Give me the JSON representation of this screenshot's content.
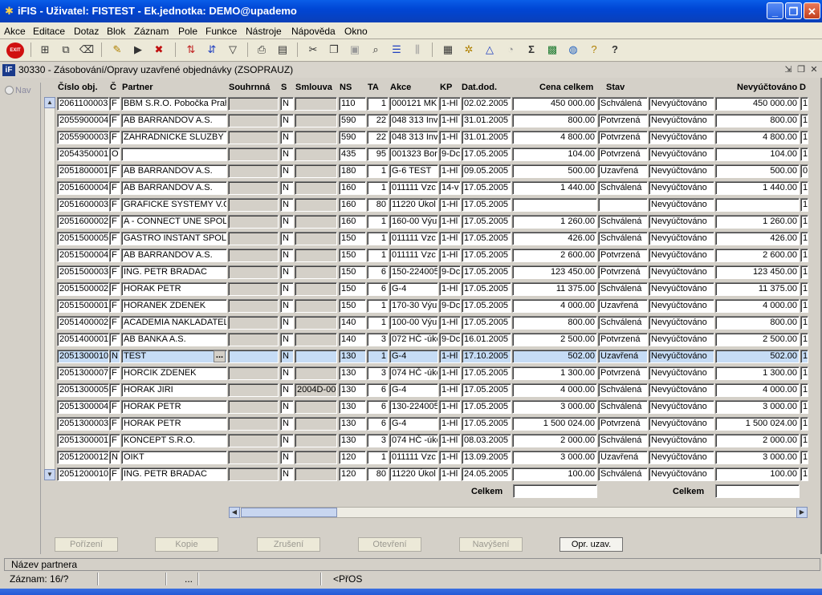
{
  "window": {
    "title": "iFIS - Uživatel: FISTEST - Ek.jednotka: DEMO@upademo",
    "minimize": "_",
    "restore": "❐",
    "close": "✕"
  },
  "menu": [
    "Akce",
    "Editace",
    "Dotaz",
    "Blok",
    "Záznam",
    "Pole",
    "Funkce",
    "Nástroje",
    "Nápověda",
    "Okno"
  ],
  "toolbar": {
    "exit_label": "EXIT"
  },
  "form": {
    "icon_text": "iF",
    "title": "30330 - Zásobování/Opravy uzavřené objednávky (ZSOPRAUZ)"
  },
  "nav": {
    "label": "Nav"
  },
  "columns": [
    "Číslo obj.",
    "Č",
    "Partner",
    "Souhrnná",
    "S",
    "Smlouva",
    "NS",
    "TA",
    "Akce",
    "KP",
    "Dat.dod.",
    "Cena celkem",
    "Stav",
    "",
    "Nevyúčtováno",
    "D"
  ],
  "rows": [
    {
      "cislo": "2061100003",
      "c": "F",
      "partner": "BBM S.R.O. Pobočka Prah",
      "souhrnna": "",
      "s": "N",
      "smlouva": "",
      "ns": "110",
      "ta": "1",
      "akce": "000121 MK",
      "kp": "1-Hl",
      "datdod": "02.02.2005",
      "cena": "450 000.00",
      "stav": "Schválená",
      "vyuct": "Nevyúčtováno",
      "nevyuct": "450 000.00",
      "d": "1"
    },
    {
      "cislo": "2055900004",
      "c": "F",
      "partner": "AB BARRANDOV A.S.",
      "souhrnna": "",
      "s": "N",
      "smlouva": "",
      "ns": "590",
      "ta": "22",
      "akce": "048 313 Inv",
      "kp": "1-Hl",
      "datdod": "31.01.2005",
      "cena": "800.00",
      "stav": "Potvrzená",
      "vyuct": "Nevyúčtováno",
      "nevyuct": "800.00",
      "d": "1"
    },
    {
      "cislo": "2055900003",
      "c": "F",
      "partner": "ZAHRADNICKE SLUZBY",
      "souhrnna": "",
      "s": "N",
      "smlouva": "",
      "ns": "590",
      "ta": "22",
      "akce": "048 313 Inv",
      "kp": "1-Hl",
      "datdod": "31.01.2005",
      "cena": "4 800.00",
      "stav": "Potvrzená",
      "vyuct": "Nevyúčtováno",
      "nevyuct": "4 800.00",
      "d": "1"
    },
    {
      "cislo": "2054350001",
      "c": "O",
      "partner": "",
      "souhrnna": "",
      "s": "N",
      "smlouva": "",
      "ns": "435",
      "ta": "95",
      "akce": "001323 Bor",
      "kp": "9-Dc",
      "datdod": "17.05.2005",
      "cena": "104.00",
      "stav": "Potvrzená",
      "vyuct": "Nevyúčtováno",
      "nevyuct": "104.00",
      "d": "1"
    },
    {
      "cislo": "2051800001",
      "c": "F",
      "partner": "AB BARRANDOV A.S.",
      "souhrnna": "",
      "s": "N",
      "smlouva": "",
      "ns": "180",
      "ta": "1",
      "akce": "G-6 TEST",
      "kp": "1-Hl",
      "datdod": "09.05.2005",
      "cena": "500.00",
      "stav": "Uzavřená",
      "vyuct": "Nevyúčtováno",
      "nevyuct": "500.00",
      "d": "0"
    },
    {
      "cislo": "2051600004",
      "c": "F",
      "partner": "AB BARRANDOV A.S.",
      "souhrnna": "",
      "s": "N",
      "smlouva": "",
      "ns": "160",
      "ta": "1",
      "akce": "011111 Vzc",
      "kp": "14-v",
      "datdod": "17.05.2005",
      "cena": "1 440.00",
      "stav": "Schválená",
      "vyuct": "Nevyúčtováno",
      "nevyuct": "1 440.00",
      "d": "1"
    },
    {
      "cislo": "2051600003",
      "c": "F",
      "partner": "GRAFICKE SYSTEMY V.O",
      "souhrnna": "",
      "s": "N",
      "smlouva": "",
      "ns": "160",
      "ta": "80",
      "akce": "11220 Úkol",
      "kp": "1-Hl",
      "datdod": "17.05.2005",
      "cena": "",
      "stav": "",
      "vyuct": "Nevyúčtováno",
      "nevyuct": "",
      "d": "1"
    },
    {
      "cislo": "2051600002",
      "c": "F",
      "partner": "A - CONNECT UNE SPOL.",
      "souhrnna": "",
      "s": "N",
      "smlouva": "",
      "ns": "160",
      "ta": "1",
      "akce": "160-00 Výu",
      "kp": "1-Hl",
      "datdod": "17.05.2005",
      "cena": "1 260.00",
      "stav": "Schválená",
      "vyuct": "Nevyúčtováno",
      "nevyuct": "1 260.00",
      "d": "1"
    },
    {
      "cislo": "2051500005",
      "c": "F",
      "partner": "GASTRO INSTANT SPOL.",
      "souhrnna": "",
      "s": "N",
      "smlouva": "",
      "ns": "150",
      "ta": "1",
      "akce": "011111 Vzc",
      "kp": "1-Hl",
      "datdod": "17.05.2005",
      "cena": "426.00",
      "stav": "Schválená",
      "vyuct": "Nevyúčtováno",
      "nevyuct": "426.00",
      "d": "1"
    },
    {
      "cislo": "2051500004",
      "c": "F",
      "partner": "AB BARRANDOV A.S.",
      "souhrnna": "",
      "s": "N",
      "smlouva": "",
      "ns": "150",
      "ta": "1",
      "akce": "011111 Vzc",
      "kp": "1-Hl",
      "datdod": "17.05.2005",
      "cena": "2 600.00",
      "stav": "Potvrzená",
      "vyuct": "Nevyúčtováno",
      "nevyuct": "2 600.00",
      "d": "1"
    },
    {
      "cislo": "2051500003",
      "c": "F",
      "partner": "ING. PETR BRADAC",
      "souhrnna": "",
      "s": "N",
      "smlouva": "",
      "ns": "150",
      "ta": "6",
      "akce": "150-224005",
      "kp": "9-Dc",
      "datdod": "17.05.2005",
      "cena": "123 450.00",
      "stav": "Potvrzená",
      "vyuct": "Nevyúčtováno",
      "nevyuct": "123 450.00",
      "d": "1"
    },
    {
      "cislo": "2051500002",
      "c": "F",
      "partner": "HORAK PETR",
      "souhrnna": "",
      "s": "N",
      "smlouva": "",
      "ns": "150",
      "ta": "6",
      "akce": "G-4",
      "kp": "1-Hl",
      "datdod": "17.05.2005",
      "cena": "11 375.00",
      "stav": "Schválená",
      "vyuct": "Nevyúčtováno",
      "nevyuct": "11 375.00",
      "d": "1"
    },
    {
      "cislo": "2051500001",
      "c": "F",
      "partner": "HORANEK ZDENEK",
      "souhrnna": "",
      "s": "N",
      "smlouva": "",
      "ns": "150",
      "ta": "1",
      "akce": "170-30 Výu",
      "kp": "9-Dc",
      "datdod": "17.05.2005",
      "cena": "4 000.00",
      "stav": "Uzavřená",
      "vyuct": "Nevyúčtováno",
      "nevyuct": "4 000.00",
      "d": "1"
    },
    {
      "cislo": "2051400002",
      "c": "F",
      "partner": "ACADEMIA NAKLADATEL",
      "souhrnna": "",
      "s": "N",
      "smlouva": "",
      "ns": "140",
      "ta": "1",
      "akce": "100-00 Výu",
      "kp": "1-Hl",
      "datdod": "17.05.2005",
      "cena": "800.00",
      "stav": "Schválená",
      "vyuct": "Nevyúčtováno",
      "nevyuct": "800.00",
      "d": "1"
    },
    {
      "cislo": "2051400001",
      "c": "F",
      "partner": "AB BANKA A.S.",
      "souhrnna": "",
      "s": "N",
      "smlouva": "",
      "ns": "140",
      "ta": "3",
      "akce": "072 HČ -úkc",
      "kp": "9-Dc",
      "datdod": "16.01.2005",
      "cena": "2 500.00",
      "stav": "Potvrzená",
      "vyuct": "Nevyúčtováno",
      "nevyuct": "2 500.00",
      "d": "1"
    },
    {
      "cislo": "2051300010",
      "c": "N",
      "partner": "TEST",
      "souhrnna": "",
      "s": "N",
      "smlouva": "",
      "ns": "130",
      "ta": "1",
      "akce": "G-4",
      "kp": "1-Hl",
      "datdod": "17.10.2005",
      "cena": "502.00",
      "stav": "Uzavřená",
      "vyuct": "Nevyúčtováno",
      "nevyuct": "502.00",
      "d": "1"
    },
    {
      "cislo": "2051300007",
      "c": "F",
      "partner": "HORCIK ZDENEK",
      "souhrnna": "",
      "s": "N",
      "smlouva": "",
      "ns": "130",
      "ta": "3",
      "akce": "074 HČ -úkc",
      "kp": "1-Hl",
      "datdod": "17.05.2005",
      "cena": "1 300.00",
      "stav": "Potvrzená",
      "vyuct": "Nevyúčtováno",
      "nevyuct": "1 300.00",
      "d": "1"
    },
    {
      "cislo": "2051300005",
      "c": "F",
      "partner": "HORAK JIRI",
      "souhrnna": "",
      "s": "N",
      "smlouva": "2004D-00",
      "ns": "130",
      "ta": "6",
      "akce": "G-4",
      "kp": "1-Hl",
      "datdod": "17.05.2005",
      "cena": "4 000.00",
      "stav": "Schválená",
      "vyuct": "Nevyúčtováno",
      "nevyuct": "4 000.00",
      "d": "1"
    },
    {
      "cislo": "2051300004",
      "c": "F",
      "partner": "HORAK PETR",
      "souhrnna": "",
      "s": "N",
      "smlouva": "",
      "ns": "130",
      "ta": "6",
      "akce": "130-224005",
      "kp": "1-Hl",
      "datdod": "17.05.2005",
      "cena": "3 000.00",
      "stav": "Schválená",
      "vyuct": "Nevyúčtováno",
      "nevyuct": "3 000.00",
      "d": "1"
    },
    {
      "cislo": "2051300003",
      "c": "F",
      "partner": "HORAK PETR",
      "souhrnna": "",
      "s": "N",
      "smlouva": "",
      "ns": "130",
      "ta": "6",
      "akce": "G-4",
      "kp": "1-Hl",
      "datdod": "17.05.2005",
      "cena": "1 500 024.00",
      "stav": "Potvrzená",
      "vyuct": "Nevyúčtováno",
      "nevyuct": "1 500 024.00",
      "d": "1"
    },
    {
      "cislo": "2051300001",
      "c": "F",
      "partner": "KONCEPT S.R.O.",
      "souhrnna": "",
      "s": "N",
      "smlouva": "",
      "ns": "130",
      "ta": "3",
      "akce": "074 HČ -úkc",
      "kp": "1-Hl",
      "datdod": "08.03.2005",
      "cena": "2 000.00",
      "stav": "Schválená",
      "vyuct": "Nevyúčtováno",
      "nevyuct": "2 000.00",
      "d": "1"
    },
    {
      "cislo": "2051200012",
      "c": "N",
      "partner": "OIKT",
      "souhrnna": "",
      "s": "N",
      "smlouva": "",
      "ns": "120",
      "ta": "1",
      "akce": "011111 Vzc",
      "kp": "1-Hl",
      "datdod": "13.09.2005",
      "cena": "3 000.00",
      "stav": "Uzavřená",
      "vyuct": "Nevyúčtováno",
      "nevyuct": "3 000.00",
      "d": "1"
    },
    {
      "cislo": "2051200010",
      "c": "F",
      "partner": "ING. PETR BRADAC",
      "souhrnna": "",
      "s": "N",
      "smlouva": "",
      "ns": "120",
      "ta": "80",
      "akce": "11220 Úkol",
      "kp": "1-Hl",
      "datdod": "24.05.2005",
      "cena": "100.00",
      "stav": "Schválená",
      "vyuct": "Nevyúčtováno",
      "nevyuct": "100.00",
      "d": "1"
    }
  ],
  "selected_row": 15,
  "lov_button": "...",
  "totals": {
    "label1": "Celkem",
    "label2": "Celkem"
  },
  "buttons": {
    "porizeni": "Pořízení",
    "kopie": "Kopie",
    "zruseni": "Zrušení",
    "otevreni": "Otevření",
    "navyseni": "Navýšení",
    "opr_uzav": "Opr. uzav."
  },
  "status": {
    "hint": "Název partnera",
    "record": "Záznam: 16/?",
    "dots": "...",
    "mode": "<PřOS"
  }
}
